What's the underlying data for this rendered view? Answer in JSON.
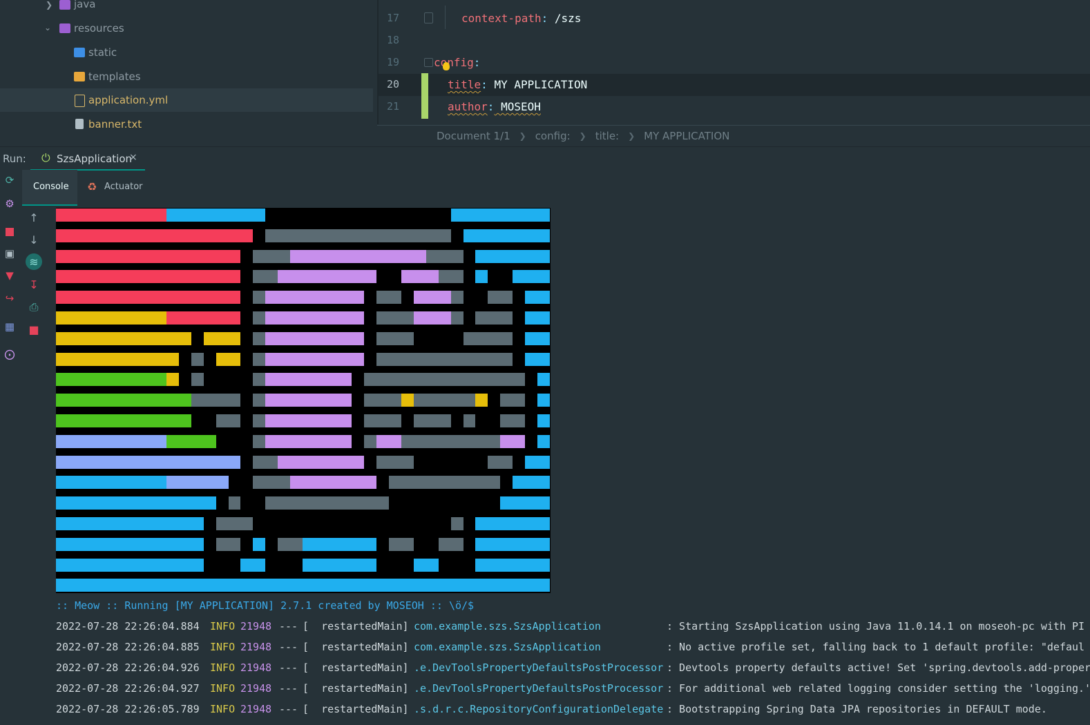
{
  "tree": {
    "items": [
      {
        "label": "java",
        "icon": "java-package-icon",
        "color": "#9c5fd1"
      },
      {
        "label": "resources",
        "icon": "resources-folder-icon",
        "color": "#9c5fd1"
      },
      {
        "label": "static",
        "icon": "web-folder-icon",
        "color": "#3d8fe6"
      },
      {
        "label": "templates",
        "icon": "folder-icon",
        "color": "#e8a73b"
      },
      {
        "label": "application.yml",
        "icon": "yaml-file-icon",
        "color": "#d9b86a"
      },
      {
        "label": "banner.txt",
        "icon": "text-file-icon",
        "color": "#b0bec5"
      }
    ]
  },
  "editor": {
    "lines": [
      {
        "num": "17",
        "key": "context-path",
        "colon": ":",
        "value": " /szs"
      },
      {
        "num": "18",
        "key": "",
        "colon": "",
        "value": ""
      },
      {
        "num": "19",
        "key": "config",
        "colon": ":",
        "value": ""
      },
      {
        "num": "20",
        "key": "title",
        "colon": ":",
        "value": " MY APPLICATION"
      },
      {
        "num": "21",
        "key": "author",
        "colon": ":",
        "value": " MOSEOH"
      }
    ],
    "breadcrumb": [
      "Document 1/1",
      "config:",
      "title:",
      "MY APPLICATION"
    ]
  },
  "run": {
    "label": "Run:",
    "tab_name": "SzsApplication",
    "close_glyph": "×",
    "subtabs": {
      "console": "Console",
      "actuator": "Actuator"
    }
  },
  "colors": {
    "accent": "#009688",
    "banner_red": "#f53d5a",
    "banner_blue": "#1fb0f0",
    "banner_yellow": "#e6be0a",
    "banner_green": "#4ec41e",
    "banner_periwinkle": "#8aa8f8",
    "banner_lilac": "#c78fec",
    "banner_gray": "#5b6b73"
  },
  "console": {
    "meow": ":: Meow :: Running [MY APPLICATION] 2.7.1 created by MOSEOH :: \\ö/$",
    "lines": [
      {
        "ts": "2022-07-28 22:26:04.884",
        "level": "INFO",
        "pid": "21948",
        "dash": "---",
        "thread": "[  restartedMain]",
        "logger": "com.example.szs.SzsApplication",
        "msg": ": Starting SzsApplication using Java 11.0.14.1 on moseoh-pc with PI"
      },
      {
        "ts": "2022-07-28 22:26:04.885",
        "level": "INFO",
        "pid": "21948",
        "dash": "---",
        "thread": "[  restartedMain]",
        "logger": "com.example.szs.SzsApplication",
        "msg": ": No active profile set, falling back to 1 default profile: \"defaul"
      },
      {
        "ts": "2022-07-28 22:26:04.926",
        "level": "INFO",
        "pid": "21948",
        "dash": "---",
        "thread": "[  restartedMain]",
        "logger": ".e.DevToolsPropertyDefaultsPostProcessor",
        "msg": ": Devtools property defaults active! Set 'spring.devtools.add-proper"
      },
      {
        "ts": "2022-07-28 22:26:04.927",
        "level": "INFO",
        "pid": "21948",
        "dash": "---",
        "thread": "[  restartedMain]",
        "logger": ".e.DevToolsPropertyDefaultsPostProcessor",
        "msg": ": For additional web related logging consider setting the 'logging.'"
      },
      {
        "ts": "2022-07-28 22:26:05.789",
        "level": "INFO",
        "pid": "21948",
        "dash": "---",
        "thread": "[  restartedMain]",
        "logger": ".s.d.r.c.RepositoryConfigurationDelegate",
        "msg": ": Bootstrapping Spring Data JPA repositories in DEFAULT mode."
      }
    ]
  }
}
